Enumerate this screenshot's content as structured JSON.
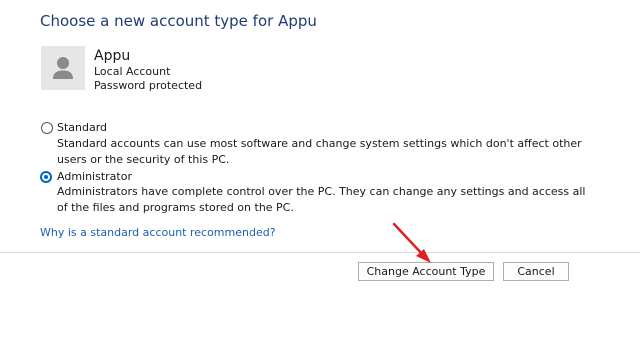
{
  "heading": "Choose a new account type for Appu",
  "user": {
    "name": "Appu",
    "type": "Local Account",
    "status": "Password protected"
  },
  "options": [
    {
      "label": "Standard",
      "description": "Standard accounts can use most software and change system settings which don't affect other users or the security of this PC.",
      "selected": false
    },
    {
      "label": "Administrator",
      "description": "Administrators have complete control over the PC. They can change any settings and access all of the files and programs stored on the PC.",
      "selected": true
    }
  ],
  "help_link": "Why is a standard account recommended?",
  "buttons": {
    "change": "Change Account Type",
    "cancel": "Cancel"
  },
  "colors": {
    "accent": "#0067c0",
    "heading": "#1f3a75",
    "link": "#1a5fb4",
    "annotation_arrow": "#e02020"
  }
}
